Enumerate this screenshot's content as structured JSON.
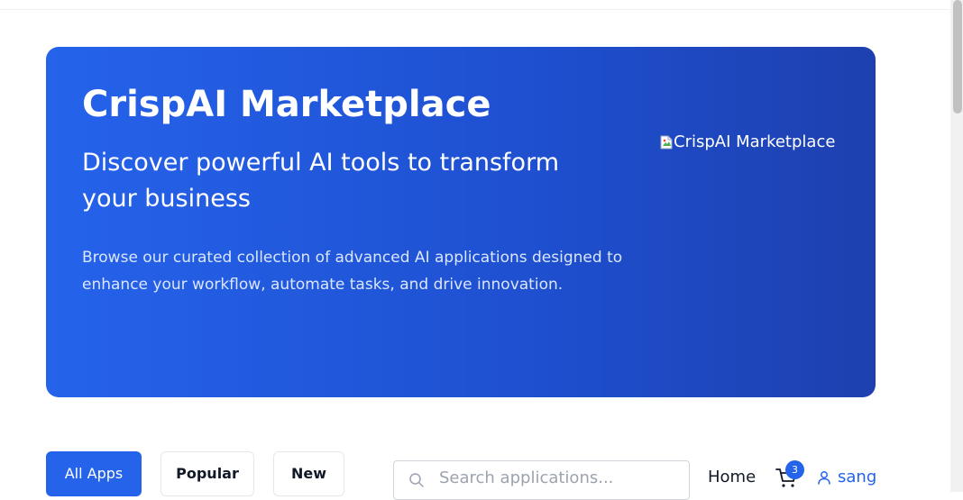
{
  "hero": {
    "title": "CrispAI Marketplace",
    "subtitle": "Discover powerful AI tools to transform your business",
    "description": "Browse our curated collection of advanced AI applications designed to enhance your workflow, automate tasks, and drive innovation.",
    "image_alt": "CrispAI Marketplace",
    "background_start": "#2563eb",
    "background_end": "#1e40af"
  },
  "tabs": {
    "all": "All Apps",
    "popular": "Popular",
    "new": "New",
    "active": "All Apps"
  },
  "search": {
    "placeholder": "Search applications...",
    "value": ""
  },
  "nav": {
    "home": "Home",
    "cart_count": "3",
    "username": "sang"
  },
  "icons": {
    "search": "search-icon",
    "cart": "cart-icon",
    "user": "user-icon",
    "broken_image": "broken-image-icon"
  },
  "colors": {
    "accent": "#2563eb",
    "text": "#111827",
    "border": "#e5e7eb"
  }
}
